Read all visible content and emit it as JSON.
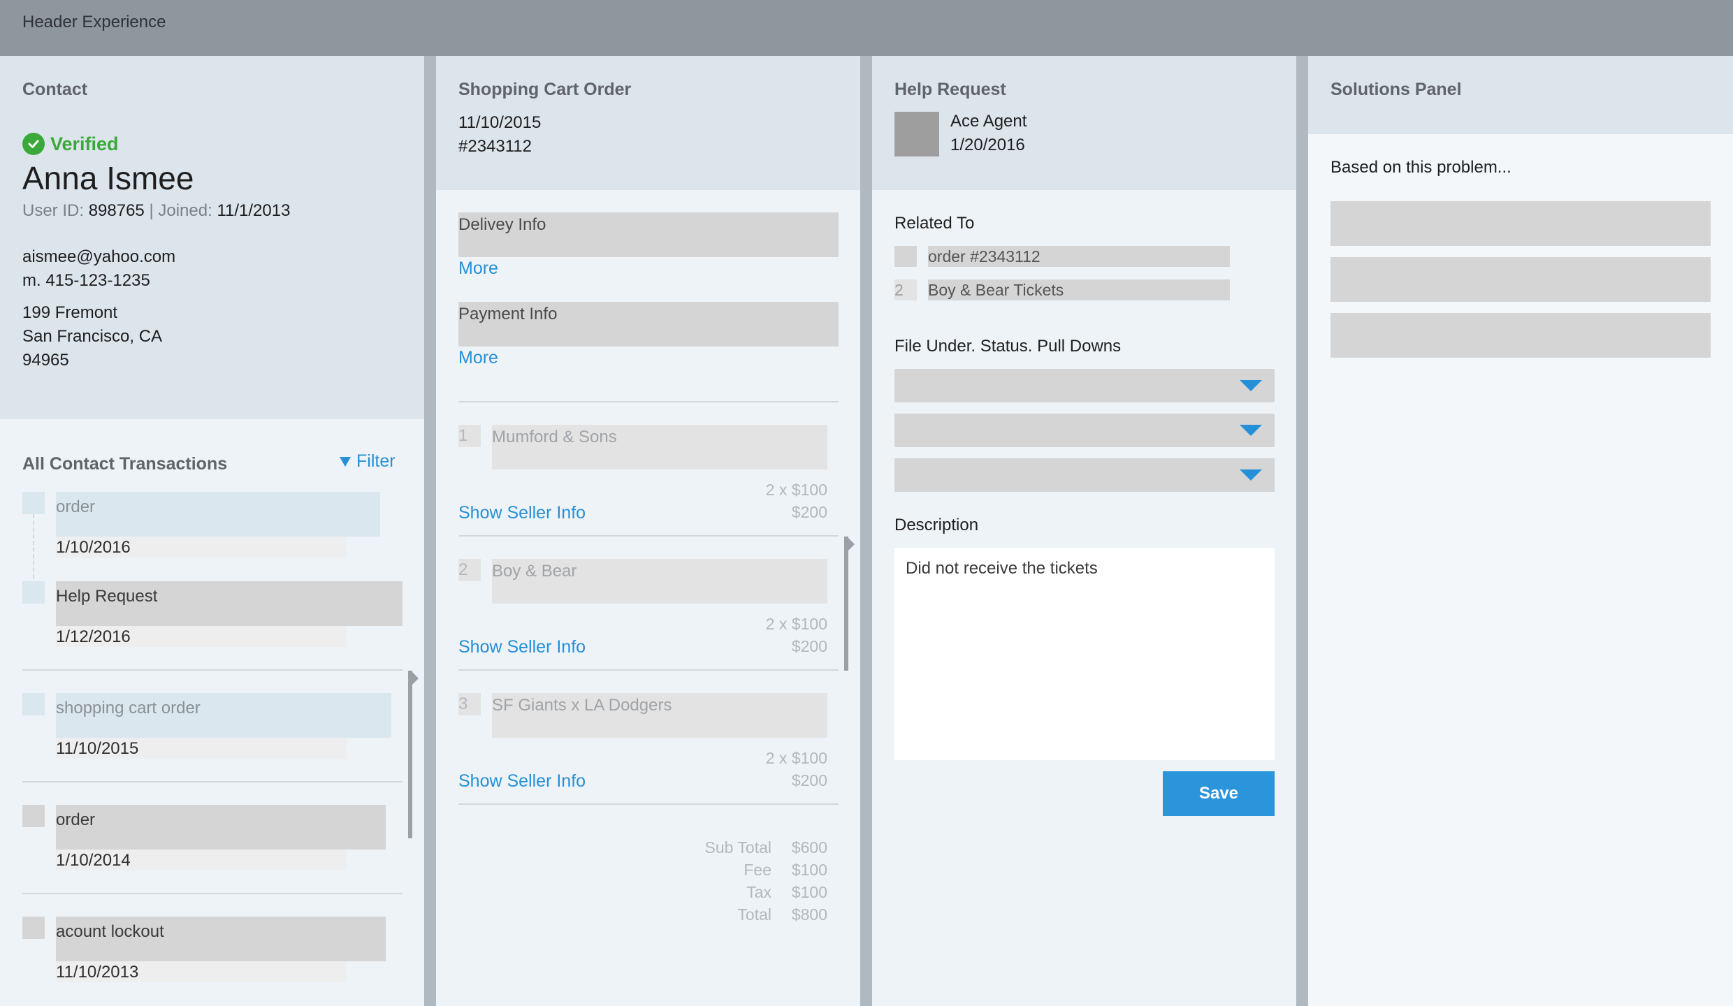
{
  "header": {
    "title": "Header Experience"
  },
  "contact": {
    "title": "Contact",
    "verified": "Verified",
    "name": "Anna Ismee",
    "user_id_label": "User ID:",
    "user_id": "898765",
    "separator": "|",
    "joined_label": "Joined",
    "joined_colon": ":",
    "joined": "11/1/2013",
    "email": "aismee@yahoo.com",
    "phone": "m. 415-123-1235",
    "address_line1": "199 Fremont",
    "address_line2": "San Francisco, CA",
    "address_line3": "94965"
  },
  "transactions": {
    "title": "All Contact Transactions",
    "filter": "Filter",
    "items": [
      {
        "label": "order",
        "date": "1/10/2016"
      },
      {
        "label": "Help Request",
        "date": "1/12/2016"
      },
      {
        "label": "shopping cart order",
        "date": "11/10/2015"
      },
      {
        "label": "order",
        "date": "1/10/2014"
      },
      {
        "label": "acount lockout",
        "date": "11/10/2013"
      }
    ]
  },
  "cart": {
    "title": "Shopping Cart Order",
    "date": "11/10/2015",
    "order_number": "#2343112",
    "delivery_label": "Delivey Info",
    "payment_label": "Payment Info",
    "more": "More",
    "show_seller": "Show Seller Info",
    "items": [
      {
        "num": "1",
        "name": "Mumford & Sons",
        "qty": "2 x $100",
        "price": "$200"
      },
      {
        "num": "2",
        "name": "Boy & Bear",
        "qty": "2 x $100",
        "price": "$200"
      },
      {
        "num": "3",
        "name": "SF Giants x LA Dodgers",
        "qty": "2 x $100",
        "price": "$200"
      }
    ],
    "totals": [
      {
        "label": "Sub Total",
        "value": "$600"
      },
      {
        "label": "Fee",
        "value": "$100"
      },
      {
        "label": "Tax",
        "value": "$100"
      },
      {
        "label": "Total",
        "value": "$800"
      }
    ]
  },
  "help": {
    "title": "Help Request",
    "agent": "Ace Agent",
    "date": "1/20/2016",
    "related_title": "Related To",
    "related": [
      {
        "num": "",
        "label": "order #2343112"
      },
      {
        "num": "2",
        "label": "Boy & Bear Tickets"
      }
    ],
    "file_under_title": "File Under. Status. Pull Downs",
    "description_title": "Description",
    "description": "Did not receive the tickets",
    "save": "Save"
  },
  "solutions": {
    "title": "Solutions Panel",
    "intro": "Based on this problem..."
  }
}
